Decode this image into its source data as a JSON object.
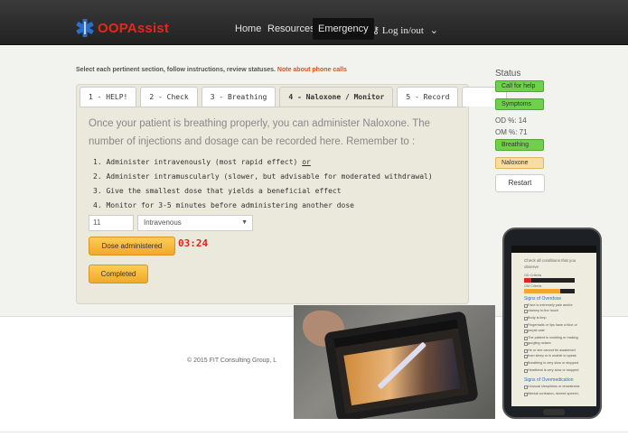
{
  "navbar": {
    "brand": "OOPAssist",
    "links": [
      "Home",
      "Resources",
      "Emergency"
    ],
    "active": "Emergency",
    "login": "Log in/out"
  },
  "instructions": {
    "text": "Select each pertinent section, follow instructions, review statuses. ",
    "note": "Note about phone calls"
  },
  "tabs": [
    {
      "label": "1 - HELP!"
    },
    {
      "label": "2 - Check"
    },
    {
      "label": "3 - Breathing"
    },
    {
      "label": "4 - Naloxone / Monitor",
      "active": true
    },
    {
      "label": "5 - Record"
    }
  ],
  "main": {
    "intro": "Once your patient is breathing properly, you can administer Naloxone. The number of injections and dosage can be recorded here. Remember to :",
    "steps": [
      {
        "text": "1. Administer intravenously (most rapid effect) ",
        "emph": "or"
      },
      {
        "text": "2. Administer intramuscularly (slower, but advisable for moderated withdrawal)",
        "emph": ""
      },
      {
        "text": "3. Give the smallest dose that yields a beneficial effect",
        "emph": ""
      },
      {
        "text": "4. Monitor for 3-5 minutes before administering another dose",
        "emph": ""
      }
    ],
    "dose_value": "11",
    "route_selected": "Intravenous",
    "dose_button": "Dose administered",
    "timer": "03:24",
    "completed_button": "Completed"
  },
  "status": {
    "title": "Status",
    "call": "Call for help",
    "symptoms": "Symptoms",
    "od": "OD %: 14",
    "om": "OM %: 71",
    "breathing": "Breathing",
    "naloxone": "Naloxone",
    "restart": "Restart"
  },
  "footer": "© 2015 FIT Consulting Group, L",
  "phone": {
    "title_line1": "Check all conditions that you",
    "title_line2": "observe",
    "od_label": "OD Criteria",
    "om_label": "OM Criteria",
    "section1": "Signs of Overdose",
    "items1": [
      "Face is extremely pale and/or",
      "clammy to the touch",
      "Body is limp",
      "Fingernails or lips have a blue or",
      "purple cast",
      "The patient is vomiting or making",
      "gurgling noises",
      "He or she cannot be awakened",
      "from sleep or is unable to speak",
      "Breathing is very slow or stopped",
      "Heartbeat is very slow or stopped"
    ],
    "section2": "Signs of Overmedication",
    "items2": [
      "Unusual sleepiness or drowsiness",
      "Mental confusion, slurred speech,"
    ],
    "od_fill": 0.14,
    "om_fill": 0.71
  },
  "colors": {
    "brand": "#e8261f",
    "note": "#e04f1b",
    "timer": "#e0241b",
    "green": "#6fd14b",
    "orange": "#f8dda2",
    "button_orange": "#f0a92a"
  }
}
